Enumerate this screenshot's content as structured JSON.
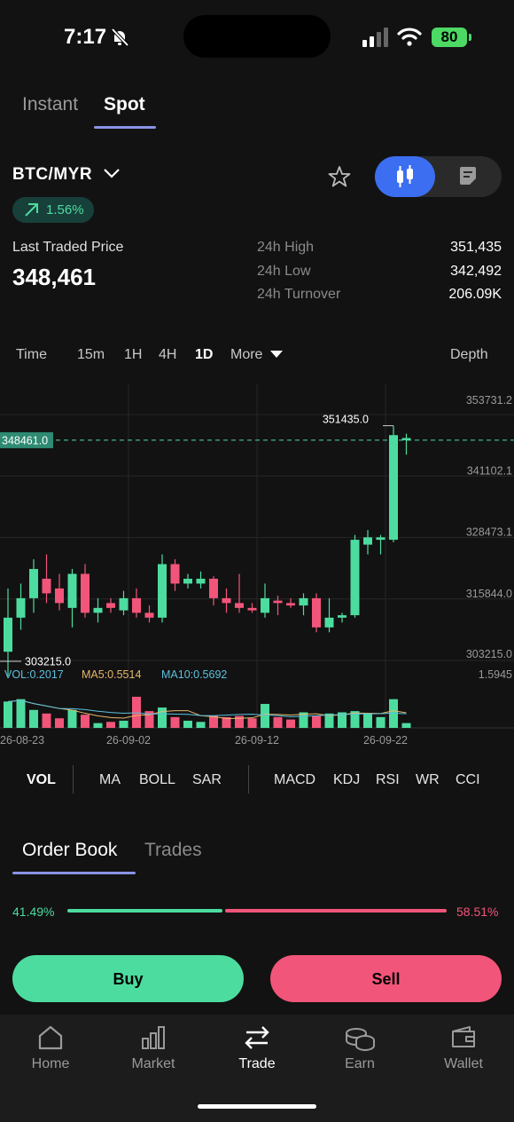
{
  "status": {
    "time": "7:17",
    "battery": "80"
  },
  "mode_tabs": [
    {
      "label": "Instant"
    },
    {
      "label": "Spot"
    }
  ],
  "ticker": {
    "pair": "BTC/MYR",
    "change": "1.56%",
    "last_price_label": "Last Traded Price",
    "last_price": "348,461",
    "high_label": "24h High",
    "high": "351,435",
    "low_label": "24h Low",
    "low": "342,492",
    "turnover_label": "24h Turnover",
    "turnover": "206.09K"
  },
  "timeframes": [
    "Time",
    "15m",
    "1H",
    "4H",
    "1D",
    "More",
    "Depth"
  ],
  "chart": {
    "current_price_tag": "348461.0",
    "high_marker": "351435.0",
    "low_marker": "303215.0",
    "price_axis": [
      "353731.2",
      "341102.1",
      "328473.1",
      "315844.0",
      "303215.0"
    ],
    "vol_axis": "1.5945",
    "vol_legend": {
      "vol": "VOL:0.2017",
      "ma5": "MA5:0.5514",
      "ma10": "MA10:0.5692"
    },
    "dates": [
      "26-08-23",
      "26-09-02",
      "26-09-12",
      "26-09-22"
    ],
    "colors": {
      "up": "#4ddc9f",
      "down": "#f2557a",
      "ma5": "#e6b86a",
      "ma10": "#5bc0de"
    }
  },
  "chart_data": {
    "type": "candlestick",
    "ylim": [
      303215.0,
      353731.2
    ],
    "candles": [
      {
        "o": 305000,
        "h": 318000,
        "l": 300000,
        "c": 312000
      },
      {
        "o": 312000,
        "h": 319000,
        "l": 309500,
        "c": 316000
      },
      {
        "o": 316000,
        "h": 324000,
        "l": 313000,
        "c": 322000
      },
      {
        "o": 320000,
        "h": 325000,
        "l": 315000,
        "c": 317000
      },
      {
        "o": 318000,
        "h": 321000,
        "l": 313500,
        "c": 315000
      },
      {
        "o": 314000,
        "h": 322000,
        "l": 310000,
        "c": 321000
      },
      {
        "o": 321000,
        "h": 323000,
        "l": 312000,
        "c": 313000
      },
      {
        "o": 313000,
        "h": 316000,
        "l": 311000,
        "c": 314000
      },
      {
        "o": 315000,
        "h": 316000,
        "l": 313000,
        "c": 314000
      },
      {
        "o": 313500,
        "h": 317500,
        "l": 312500,
        "c": 316000
      },
      {
        "o": 316000,
        "h": 318000,
        "l": 312000,
        "c": 313000
      },
      {
        "o": 313000,
        "h": 314500,
        "l": 311000,
        "c": 312000
      },
      {
        "o": 312000,
        "h": 325000,
        "l": 311000,
        "c": 323000
      },
      {
        "o": 323000,
        "h": 324000,
        "l": 317500,
        "c": 319000
      },
      {
        "o": 319000,
        "h": 321000,
        "l": 318000,
        "c": 320000
      },
      {
        "o": 319000,
        "h": 321500,
        "l": 318000,
        "c": 320000
      },
      {
        "o": 320000,
        "h": 320500,
        "l": 314500,
        "c": 316000
      },
      {
        "o": 316000,
        "h": 318000,
        "l": 313000,
        "c": 315000
      },
      {
        "o": 315000,
        "h": 321000,
        "l": 313000,
        "c": 314000
      },
      {
        "o": 314000,
        "h": 315000,
        "l": 313000,
        "c": 313500
      },
      {
        "o": 313000,
        "h": 319000,
        "l": 312000,
        "c": 316000
      },
      {
        "o": 315500,
        "h": 316500,
        "l": 312500,
        "c": 315000
      },
      {
        "o": 315000,
        "h": 316000,
        "l": 314000,
        "c": 314500
      },
      {
        "o": 314500,
        "h": 317000,
        "l": 312500,
        "c": 316000
      },
      {
        "o": 316000,
        "h": 317000,
        "l": 309000,
        "c": 310000
      },
      {
        "o": 310000,
        "h": 316000,
        "l": 309000,
        "c": 312000
      },
      {
        "o": 312000,
        "h": 313000,
        "l": 311000,
        "c": 312500
      },
      {
        "o": 312500,
        "h": 329000,
        "l": 312000,
        "c": 328000
      },
      {
        "o": 327000,
        "h": 330000,
        "l": 325000,
        "c": 328500
      },
      {
        "o": 328000,
        "h": 329000,
        "l": 325000,
        "c": 328500
      },
      {
        "o": 328000,
        "h": 351435,
        "l": 327500,
        "c": 349500
      },
      {
        "o": 348461,
        "h": 349800,
        "l": 345500,
        "c": 348900
      }
    ],
    "volumes": [
      1.1,
      1.2,
      0.75,
      0.6,
      0.4,
      0.75,
      0.55,
      0.2,
      0.25,
      0.3,
      1.3,
      0.7,
      0.85,
      0.45,
      0.3,
      0.25,
      0.5,
      0.45,
      0.5,
      0.4,
      1.0,
      0.45,
      0.35,
      0.65,
      0.5,
      0.6,
      0.65,
      0.7,
      0.6,
      0.45,
      1.2,
      0.2
    ],
    "vol_ylim": [
      0,
      1.5945
    ]
  },
  "indicators": [
    "VOL",
    "MA",
    "BOLL",
    "SAR",
    "MACD",
    "KDJ",
    "RSI",
    "WR",
    "CCI"
  ],
  "orderbook": {
    "tabs": [
      "Order Book",
      "Trades"
    ],
    "bid_pct": "41.49%",
    "ask_pct": "58.51%",
    "bid_ratio": 0.4149
  },
  "actions": {
    "buy": "Buy",
    "sell": "Sell"
  },
  "nav": [
    {
      "label": "Home",
      "icon": "home-icon"
    },
    {
      "label": "Market",
      "icon": "market-icon"
    },
    {
      "label": "Trade",
      "icon": "trade-icon"
    },
    {
      "label": "Earn",
      "icon": "earn-icon"
    },
    {
      "label": "Wallet",
      "icon": "wallet-icon"
    }
  ]
}
